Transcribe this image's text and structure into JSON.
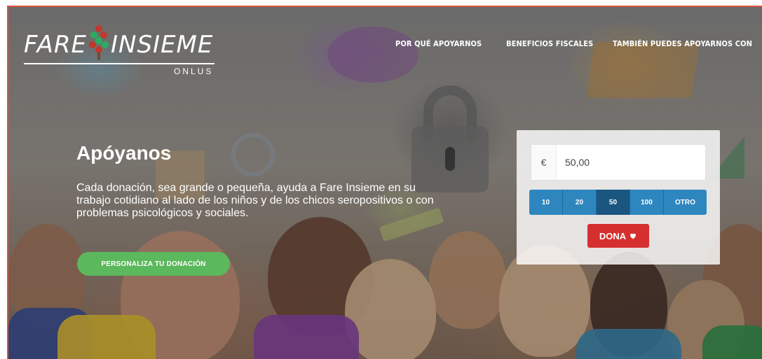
{
  "brand": {
    "name_left": "FARE",
    "name_right": "INSIEME",
    "subtitle": "ONLUS",
    "mark_icon": "tree-people-logo-icon"
  },
  "nav": {
    "items": [
      {
        "label": "POR QUÉ APOYARNOS"
      },
      {
        "label": "BENEFICIOS FISCALES"
      },
      {
        "label": "TAMBIÉN PUEDES APOYARNOS CON"
      }
    ]
  },
  "hero": {
    "title": "Apóyanos",
    "text": "Cada donación, sea grande o pequeña, ayuda a Fare Insieme en su trabajo cotidiano al lado de los niños y de los chicos seropositivos o con problemas psicológicos y sociales.",
    "cta_label": "PERSONALIZA TU DONACIÓN"
  },
  "donation": {
    "currency": "€",
    "amount": "50,00",
    "presets": [
      "10",
      "20",
      "50",
      "100",
      "OTRO"
    ],
    "selected_preset": "50",
    "submit_label": "DONA",
    "submit_icon": "heart-icon"
  },
  "colors": {
    "frame_border": "#d9563c",
    "cta_green": "#5cb85c",
    "preset_blue": "#2e86bf",
    "preset_active": "#1a5680",
    "donate_red": "#d62f2f"
  }
}
